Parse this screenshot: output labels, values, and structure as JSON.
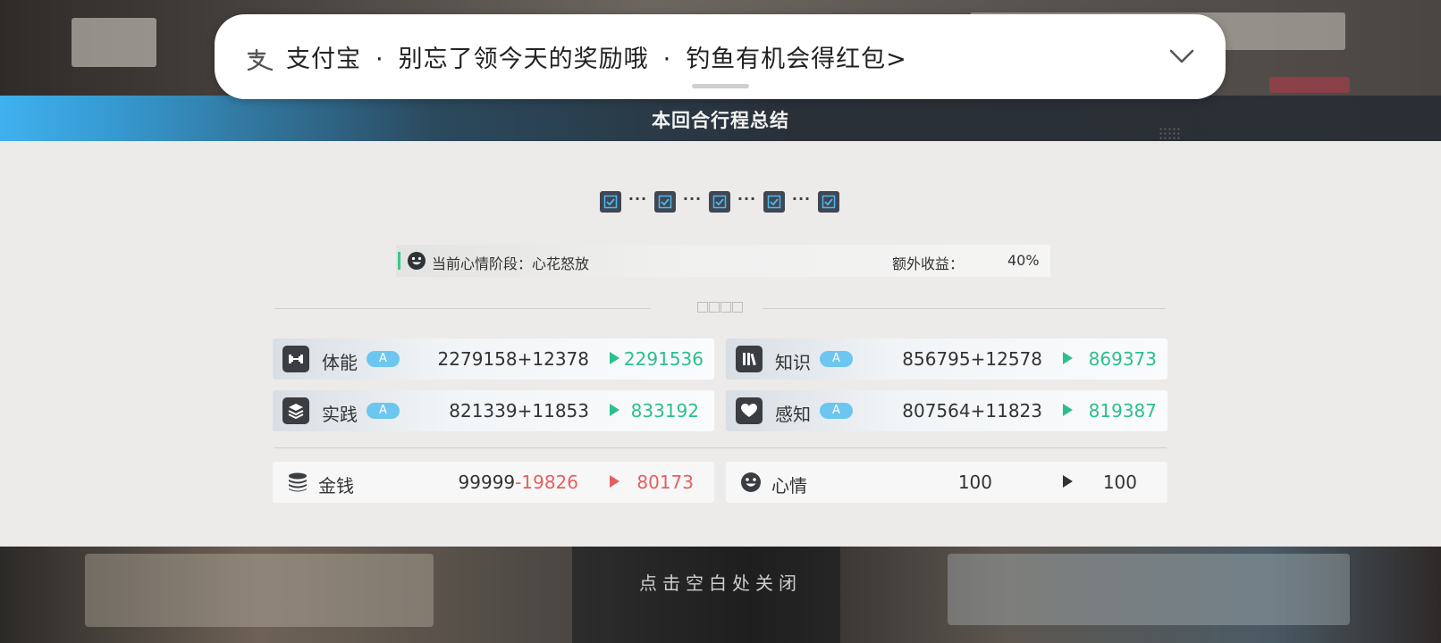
{
  "notification": {
    "app": "支付宝",
    "separator": "·",
    "message": "别忘了领今天的奖励哦",
    "action": "钓鱼有机会得红包>",
    "icon": "alipay-icon",
    "expand_icon": "chevron-down-icon"
  },
  "header": {
    "title": "本回合行程总结"
  },
  "progress": {
    "steps_completed": 5,
    "steps_total": 5,
    "separator": "···"
  },
  "mood_bar": {
    "label": "当前心情阶段：心花怒放",
    "bonus_label": "额外收益：",
    "bonus_value": "40%"
  },
  "stats": [
    {
      "name": "体能",
      "grade": "A",
      "base": "2279158",
      "delta": "+12378",
      "result": "2291536",
      "icon": "dumbbell-icon"
    },
    {
      "name": "知识",
      "grade": "A",
      "base": "856795",
      "delta": "+12578",
      "result": "869373",
      "icon": "books-icon"
    },
    {
      "name": "实践",
      "grade": "A",
      "base": "821339",
      "delta": "+11853",
      "result": "833192",
      "icon": "layers-icon"
    },
    {
      "name": "感知",
      "grade": "A",
      "base": "807564",
      "delta": "+11823",
      "result": "819387",
      "icon": "heart-icon"
    }
  ],
  "money": {
    "name": "金钱",
    "base": "99999",
    "delta": "-19826",
    "result": "80173",
    "icon": "coins-icon"
  },
  "mood": {
    "name": "心情",
    "base": "100",
    "result": "100",
    "icon": "smiley-icon"
  },
  "footer": {
    "close_hint": "点击空白处关闭"
  },
  "colors": {
    "positive": "#2bbf8e",
    "negative": "#e3615f",
    "grade_badge": "#6cc6ef",
    "accent_blue": "#3fb1ef"
  }
}
